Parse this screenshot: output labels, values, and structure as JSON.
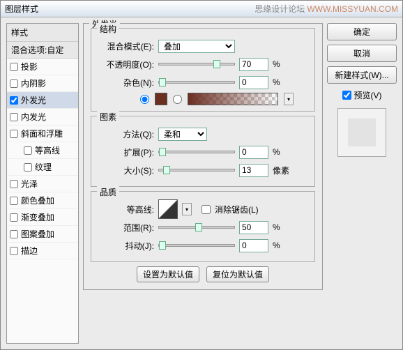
{
  "title": "图层样式",
  "watermark": {
    "text": "思缘设计论坛",
    "url": "WWW.MISSYUAN.COM"
  },
  "left": {
    "header": "样式",
    "subheader": "混合选项:自定",
    "items": [
      {
        "label": "投影",
        "checked": false
      },
      {
        "label": "内阴影",
        "checked": false
      },
      {
        "label": "外发光",
        "checked": true,
        "selected": true
      },
      {
        "label": "内发光",
        "checked": false
      },
      {
        "label": "斜面和浮雕",
        "checked": false
      },
      {
        "label": "等高线",
        "checked": false,
        "indent": true
      },
      {
        "label": "纹理",
        "checked": false,
        "indent": true
      },
      {
        "label": "光泽",
        "checked": false
      },
      {
        "label": "颜色叠加",
        "checked": false
      },
      {
        "label": "渐变叠加",
        "checked": false
      },
      {
        "label": "图案叠加",
        "checked": false
      },
      {
        "label": "描边",
        "checked": false
      }
    ]
  },
  "center": {
    "title": "外发光",
    "structure": {
      "title": "结构",
      "blend_label": "混合模式(E):",
      "blend_value": "叠加",
      "opacity_label": "不透明度(O):",
      "opacity_value": "70",
      "opacity_unit": "%",
      "noise_label": "杂色(N):",
      "noise_value": "0",
      "noise_unit": "%"
    },
    "elements": {
      "title": "图素",
      "technique_label": "方法(Q):",
      "technique_value": "柔和",
      "spread_label": "扩展(P):",
      "spread_value": "0",
      "spread_unit": "%",
      "size_label": "大小(S):",
      "size_value": "13",
      "size_unit": "像素"
    },
    "quality": {
      "title": "品质",
      "contour_label": "等高线:",
      "antialias_label": "消除锯齿(L)",
      "range_label": "范围(R):",
      "range_value": "50",
      "range_unit": "%",
      "jitter_label": "抖动(J):",
      "jitter_value": "0",
      "jitter_unit": "%"
    },
    "buttons": {
      "default": "设置为默认值",
      "reset": "复位为默认值"
    }
  },
  "right": {
    "ok": "确定",
    "cancel": "取消",
    "new_style": "新建样式(W)...",
    "preview": "预览(V)"
  }
}
